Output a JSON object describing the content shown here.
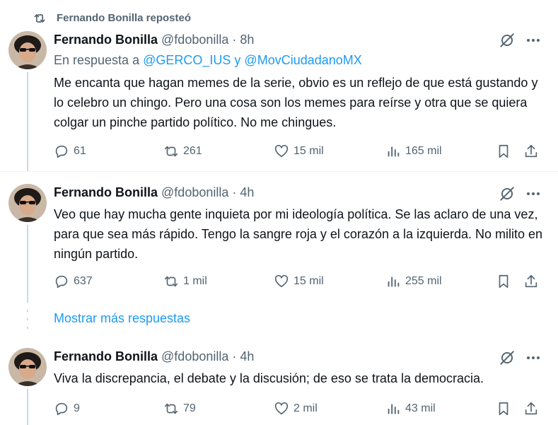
{
  "repost_banner": {
    "text": "Fernando Bonilla reposteó"
  },
  "tweets": [
    {
      "name": "Fernando Bonilla",
      "handle": "@fdobonilla",
      "separator": "·",
      "time": "8h",
      "reply_prefix": "En respuesta a",
      "reply_user_1": "@GERCO_IUS",
      "reply_joiner": "y",
      "reply_user_2": "@MovCiudadanoMX",
      "text": "Me encanta que hagan memes de la serie, obvio es un reflejo de que está gustando y lo celebro un chingo. Pero una cosa son los memes para reírse y otra que se quiera colgar un pinche partido político. No me chingues.",
      "replies": "61",
      "reposts": "261",
      "likes": "15 mil",
      "views": "165 mil"
    },
    {
      "name": "Fernando Bonilla",
      "handle": "@fdobonilla",
      "separator": "·",
      "time": "4h",
      "text": "Veo que hay mucha gente inquieta por mi ideología política. Se las aclaro de una vez, para que sea más rápido. Tengo la sangre roja y el corazón a la izquierda. No milito en ningún partido.",
      "replies": "637",
      "reposts": "1 mil",
      "likes": "15 mil",
      "views": "255 mil"
    },
    {
      "name": "Fernando Bonilla",
      "handle": "@fdobonilla",
      "separator": "·",
      "time": "4h",
      "text": "Viva la discrepancia, el debate y la discusión; de eso se trata la democracia.",
      "replies": "9",
      "reposts": "79",
      "likes": "2 mil",
      "views": "43 mil"
    }
  ],
  "show_more": {
    "label": "Mostrar más respuestas"
  },
  "colors": {
    "accent": "#1d9bf0",
    "secondary_text": "#536471",
    "primary_text": "#0f1419",
    "divider": "#eff3f4"
  },
  "icons": [
    "repost-icon",
    "grok-icon",
    "more-icon",
    "reply-icon",
    "like-icon",
    "views-icon",
    "bookmark-icon",
    "share-icon"
  ]
}
